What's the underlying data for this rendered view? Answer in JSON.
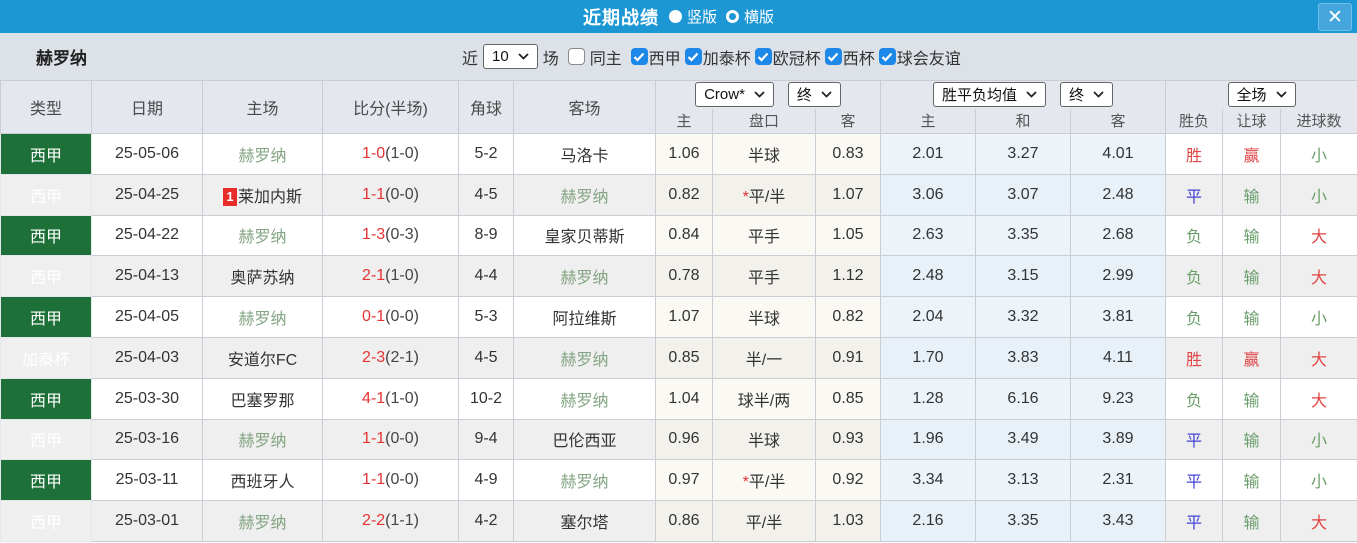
{
  "titlebar": {
    "title": "近期战绩",
    "radios": [
      {
        "label": "竖版",
        "selected": true
      },
      {
        "label": "横版",
        "selected": false
      }
    ],
    "close_label": "X"
  },
  "filterbar": {
    "team": "赫罗纳",
    "recent_label": "近",
    "recent_value": "10",
    "matches_label": "场",
    "same_host_label": "同主",
    "same_host_checked": false,
    "leagues": [
      {
        "label": "西甲",
        "checked": true
      },
      {
        "label": "加泰杯",
        "checked": true
      },
      {
        "label": "欧冠杯",
        "checked": true
      },
      {
        "label": "西杯",
        "checked": true
      },
      {
        "label": "球会友谊",
        "checked": true
      }
    ]
  },
  "header": {
    "type": "类型",
    "date": "日期",
    "home": "主场",
    "score": "比分(半场)",
    "corner": "角球",
    "away": "客场",
    "crow_select": "Crow*",
    "crow_period_select": "终",
    "avg_select": "胜平负均值",
    "avg_period_select": "终",
    "scope_select": "全场",
    "sub": {
      "crow_home": "主",
      "handicap": "盘口",
      "crow_away": "客",
      "avg_home": "主",
      "avg_draw": "和",
      "avg_away": "客",
      "wdl": "胜负",
      "handicap_result": "让球",
      "goals": "进球数"
    }
  },
  "colors": {
    "topbar_blue": "#1d97d4",
    "checkbox_blue": "#1e88e8",
    "league_green": "#1d7138",
    "cup_green": "#2f9e5f",
    "team_green": "#84a584",
    "score_red": "#e53333",
    "result_red": "#e04545",
    "result_blue": "#4343d6",
    "result_green": "#6b9e6b"
  },
  "rows": [
    {
      "type": "西甲",
      "type_style": "league",
      "date": "25-05-06",
      "home": {
        "name": "赫罗纳",
        "self": true,
        "badge": null
      },
      "score_ft": "1-0",
      "score_ht": "(1-0)",
      "corner": "5-2",
      "away": {
        "name": "马洛卡",
        "self": false
      },
      "crow": {
        "home": "1.06",
        "star": false,
        "handicap": "半球",
        "away": "0.83"
      },
      "avg": {
        "home": "2.01",
        "draw": "3.27",
        "away": "4.01"
      },
      "result": {
        "wdl": "胜",
        "wdl_c": "result_red",
        "handicap": "赢",
        "handicap_c": "result_red",
        "goals": "小",
        "goals_c": "result_green"
      }
    },
    {
      "type": "西甲",
      "type_style": "league",
      "date": "25-04-25",
      "home": {
        "name": "莱加内斯",
        "self": false,
        "badge": "1"
      },
      "score_ft": "1-1",
      "score_ht": "(0-0)",
      "corner": "4-5",
      "away": {
        "name": "赫罗纳",
        "self": true
      },
      "crow": {
        "home": "0.82",
        "star": true,
        "handicap": "平/半",
        "away": "1.07"
      },
      "avg": {
        "home": "3.06",
        "draw": "3.07",
        "away": "2.48"
      },
      "result": {
        "wdl": "平",
        "wdl_c": "result_blue",
        "handicap": "输",
        "handicap_c": "result_green",
        "goals": "小",
        "goals_c": "result_green"
      }
    },
    {
      "type": "西甲",
      "type_style": "league",
      "date": "25-04-22",
      "home": {
        "name": "赫罗纳",
        "self": true,
        "badge": null
      },
      "score_ft": "1-3",
      "score_ht": "(0-3)",
      "corner": "8-9",
      "away": {
        "name": "皇家贝蒂斯",
        "self": false
      },
      "crow": {
        "home": "0.84",
        "star": false,
        "handicap": "平手",
        "away": "1.05"
      },
      "avg": {
        "home": "2.63",
        "draw": "3.35",
        "away": "2.68"
      },
      "result": {
        "wdl": "负",
        "wdl_c": "result_green",
        "handicap": "输",
        "handicap_c": "result_green",
        "goals": "大",
        "goals_c": "result_red"
      }
    },
    {
      "type": "西甲",
      "type_style": "league",
      "date": "25-04-13",
      "home": {
        "name": "奥萨苏纳",
        "self": false,
        "badge": null
      },
      "score_ft": "2-1",
      "score_ht": "(1-0)",
      "corner": "4-4",
      "away": {
        "name": "赫罗纳",
        "self": true
      },
      "crow": {
        "home": "0.78",
        "star": false,
        "handicap": "平手",
        "away": "1.12"
      },
      "avg": {
        "home": "2.48",
        "draw": "3.15",
        "away": "2.99"
      },
      "result": {
        "wdl": "负",
        "wdl_c": "result_green",
        "handicap": "输",
        "handicap_c": "result_green",
        "goals": "大",
        "goals_c": "result_red"
      }
    },
    {
      "type": "西甲",
      "type_style": "league",
      "date": "25-04-05",
      "home": {
        "name": "赫罗纳",
        "self": true,
        "badge": null
      },
      "score_ft": "0-1",
      "score_ht": "(0-0)",
      "corner": "5-3",
      "away": {
        "name": "阿拉维斯",
        "self": false
      },
      "crow": {
        "home": "1.07",
        "star": false,
        "handicap": "半球",
        "away": "0.82"
      },
      "avg": {
        "home": "2.04",
        "draw": "3.32",
        "away": "3.81"
      },
      "result": {
        "wdl": "负",
        "wdl_c": "result_green",
        "handicap": "输",
        "handicap_c": "result_green",
        "goals": "小",
        "goals_c": "result_green"
      }
    },
    {
      "type": "加泰杯",
      "type_style": "cup",
      "date": "25-04-03",
      "home": {
        "name": "安道尔FC",
        "self": false,
        "badge": null
      },
      "score_ft": "2-3",
      "score_ht": "(2-1)",
      "corner": "4-5",
      "away": {
        "name": "赫罗纳",
        "self": true
      },
      "crow": {
        "home": "0.85",
        "star": false,
        "handicap": "半/一",
        "away": "0.91"
      },
      "avg": {
        "home": "1.70",
        "draw": "3.83",
        "away": "4.11"
      },
      "result": {
        "wdl": "胜",
        "wdl_c": "result_red",
        "handicap": "赢",
        "handicap_c": "result_red",
        "goals": "大",
        "goals_c": "result_red"
      }
    },
    {
      "type": "西甲",
      "type_style": "league",
      "date": "25-03-30",
      "home": {
        "name": "巴塞罗那",
        "self": false,
        "badge": null
      },
      "score_ft": "4-1",
      "score_ht": "(1-0)",
      "corner": "10-2",
      "away": {
        "name": "赫罗纳",
        "self": true
      },
      "crow": {
        "home": "1.04",
        "star": false,
        "handicap": "球半/两",
        "away": "0.85"
      },
      "avg": {
        "home": "1.28",
        "draw": "6.16",
        "away": "9.23"
      },
      "result": {
        "wdl": "负",
        "wdl_c": "result_green",
        "handicap": "输",
        "handicap_c": "result_green",
        "goals": "大",
        "goals_c": "result_red"
      }
    },
    {
      "type": "西甲",
      "type_style": "league",
      "date": "25-03-16",
      "home": {
        "name": "赫罗纳",
        "self": true,
        "badge": null
      },
      "score_ft": "1-1",
      "score_ht": "(0-0)",
      "corner": "9-4",
      "away": {
        "name": "巴伦西亚",
        "self": false
      },
      "crow": {
        "home": "0.96",
        "star": false,
        "handicap": "半球",
        "away": "0.93"
      },
      "avg": {
        "home": "1.96",
        "draw": "3.49",
        "away": "3.89"
      },
      "result": {
        "wdl": "平",
        "wdl_c": "result_blue",
        "handicap": "输",
        "handicap_c": "result_green",
        "goals": "小",
        "goals_c": "result_green"
      }
    },
    {
      "type": "西甲",
      "type_style": "league",
      "date": "25-03-11",
      "home": {
        "name": "西班牙人",
        "self": false,
        "badge": null
      },
      "score_ft": "1-1",
      "score_ht": "(0-0)",
      "corner": "4-9",
      "away": {
        "name": "赫罗纳",
        "self": true
      },
      "crow": {
        "home": "0.97",
        "star": true,
        "handicap": "平/半",
        "away": "0.92"
      },
      "avg": {
        "home": "3.34",
        "draw": "3.13",
        "away": "2.31"
      },
      "result": {
        "wdl": "平",
        "wdl_c": "result_blue",
        "handicap": "输",
        "handicap_c": "result_green",
        "goals": "小",
        "goals_c": "result_green"
      }
    },
    {
      "type": "西甲",
      "type_style": "league",
      "date": "25-03-01",
      "home": {
        "name": "赫罗纳",
        "self": true,
        "badge": null
      },
      "score_ft": "2-2",
      "score_ht": "(1-1)",
      "corner": "4-2",
      "away": {
        "name": "塞尔塔",
        "self": false
      },
      "crow": {
        "home": "0.86",
        "star": false,
        "handicap": "平/半",
        "away": "1.03"
      },
      "avg": {
        "home": "2.16",
        "draw": "3.35",
        "away": "3.43"
      },
      "result": {
        "wdl": "平",
        "wdl_c": "result_blue",
        "handicap": "输",
        "handicap_c": "result_green",
        "goals": "大",
        "goals_c": "result_red"
      }
    }
  ]
}
